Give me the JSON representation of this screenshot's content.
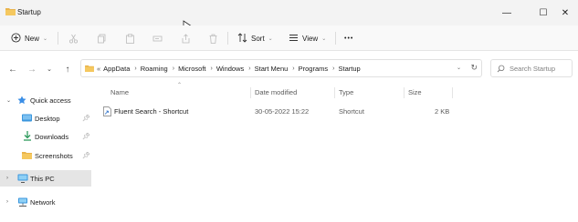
{
  "window": {
    "title": "Startup",
    "controls": {
      "minimize": "—",
      "maximize": "☐",
      "close": "✕"
    }
  },
  "toolbar": {
    "new_label": "New",
    "sort_label": "Sort",
    "view_label": "View",
    "more_label": "•••"
  },
  "navigation": {
    "back": "←",
    "forward": "→",
    "recent": "⌄",
    "up": "↑"
  },
  "address": {
    "overflow": "«",
    "crumbs": [
      "AppData",
      "Roaming",
      "Microsoft",
      "Windows",
      "Start Menu",
      "Programs",
      "Startup"
    ],
    "separator": "›"
  },
  "search": {
    "placeholder": "Search Startup"
  },
  "sidebar": {
    "quick_access": "Quick access",
    "items": [
      {
        "label": "Desktop"
      },
      {
        "label": "Downloads"
      },
      {
        "label": "Screenshots"
      }
    ],
    "this_pc": "This PC",
    "network": "Network"
  },
  "columns": {
    "name": "Name",
    "date_modified": "Date modified",
    "type": "Type",
    "size": "Size"
  },
  "files": [
    {
      "name": "Fluent Search - Shortcut",
      "date_modified": "30-05-2022 15:22",
      "type": "Shortcut",
      "size": "2 KB"
    }
  ],
  "colors": {
    "folder": "#e9b44c",
    "folder_dark": "#d89b2b",
    "selection": "#e5e5e5",
    "titlebar": "#f3f3f3",
    "accent_pc": "#3a96dd"
  }
}
